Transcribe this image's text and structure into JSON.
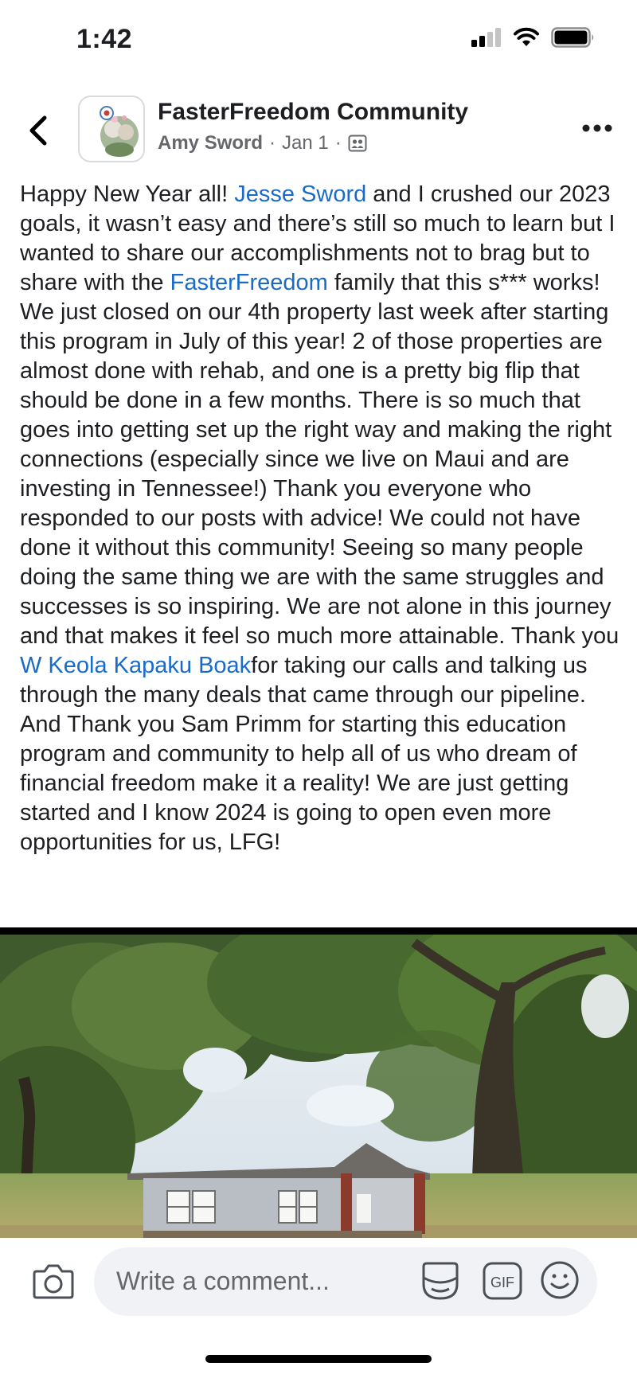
{
  "status_bar": {
    "time": "1:42"
  },
  "header": {
    "group_name": "FasterFreedom Community",
    "author": "Amy Sword",
    "separator": "·",
    "date": "Jan 1",
    "icons": [
      "back-chevron-icon",
      "group-icon",
      "more-icon"
    ]
  },
  "post": {
    "segments": [
      {
        "text": "Happy New Year all! ",
        "type": "text"
      },
      {
        "text": "Jesse Sword",
        "type": "link"
      },
      {
        "text": " and I crushed our 2023 goals, it wasn’t easy and there’s still so much to learn but I wanted to share our accomplishments not to brag but to share with the ",
        "type": "text"
      },
      {
        "text": "FasterFreedom",
        "type": "link"
      },
      {
        "text": " family that this s*** works!  We just closed on our 4th property last week after starting this program in July of this year! 2 of those properties are almost done with rehab, and one is a pretty big flip that should be done in a few months. There is so much that goes into getting set up the right way and making the right connections (especially since we live on Maui and are investing in Tennessee!) Thank you everyone who responded to our posts with advice! We could not have done it without this community! Seeing so many people doing the same thing we are with the same struggles and successes is so inspiring. We are not alone in this journey and that makes it feel so much more attainable. Thank you ",
        "type": "text"
      },
      {
        "text": "W Keola Kapaku Boak",
        "type": "link"
      },
      {
        "text": "for taking our calls and talking us through the many deals that came through our pipeline. And Thank you Sam Primm for starting this education program and community to help all of us who dream of financial freedom make it a reality! We are just getting started and I know 2024 is going to open even more opportunities for us, LFG!",
        "type": "text"
      }
    ],
    "link_color": "#1a6ac8"
  },
  "comment_bar": {
    "placeholder": "Write a comment...",
    "gif_label": "GIF",
    "icons": [
      "camera-icon",
      "sticker-icon",
      "gif-icon",
      "emoji-icon"
    ]
  },
  "colors": {
    "text": "#1c1e21",
    "secondary": "#65676b",
    "input_bg": "#f0f2f5"
  }
}
